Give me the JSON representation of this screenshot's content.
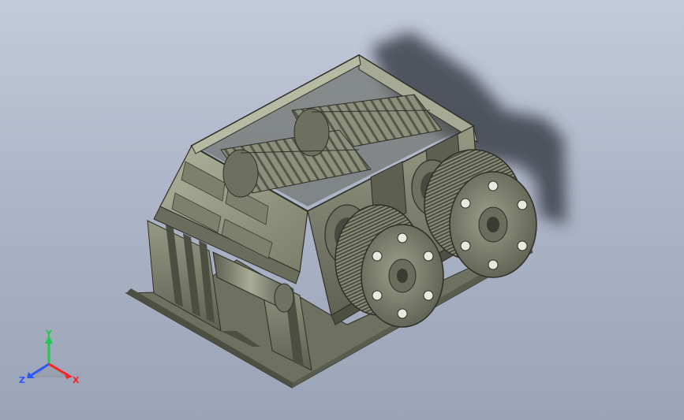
{
  "viewport": {
    "background_top": "#c3cadb",
    "background_bottom": "#9ba3b6",
    "model_color": "#8f927c",
    "model_dark": "#3a3c33",
    "shadow_color": "#3e434c"
  },
  "triad": {
    "y_label": "Y",
    "z_label": "Z",
    "x_label": "X",
    "y_color": "#22c84a",
    "z_color": "#2a55ff",
    "x_color": "#ff2222"
  }
}
